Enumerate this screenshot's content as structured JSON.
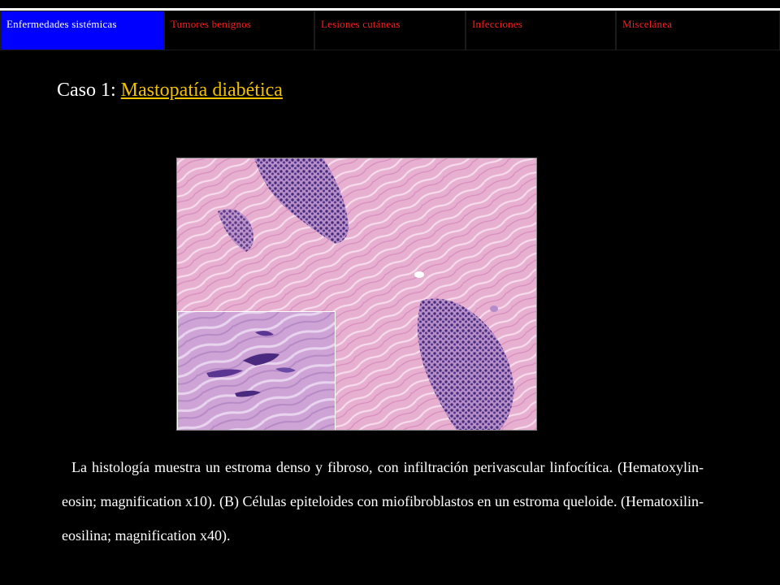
{
  "nav": {
    "tabs": [
      {
        "label": "Enfermedades sistémicas",
        "active": true
      },
      {
        "label": "Tumores benignos",
        "active": false
      },
      {
        "label": "Lesiones cutáneas",
        "active": false
      },
      {
        "label": "Infecciones",
        "active": false
      },
      {
        "label": "Miscelánea",
        "active": false
      }
    ]
  },
  "title": {
    "prefix": "Caso 1: ",
    "link": "Mastopatía diabética"
  },
  "figure": {
    "main_image": "histology-he-x10",
    "inset_image": "histology-inset-x40"
  },
  "caption": "La histología muestra un estroma denso y fibroso, con infiltración perivascular linfocítica. (Hematoxylin-eosin; magnification x10). (B) Células epiteloides con miofibroblastos en un estroma queloide. (Hematoxilin-eosilina; magnification x40).",
  "colors": {
    "background": "#000000",
    "active_tab": "#0000ff",
    "tab_text": "#ff1b1b",
    "link": "#f0c000"
  }
}
